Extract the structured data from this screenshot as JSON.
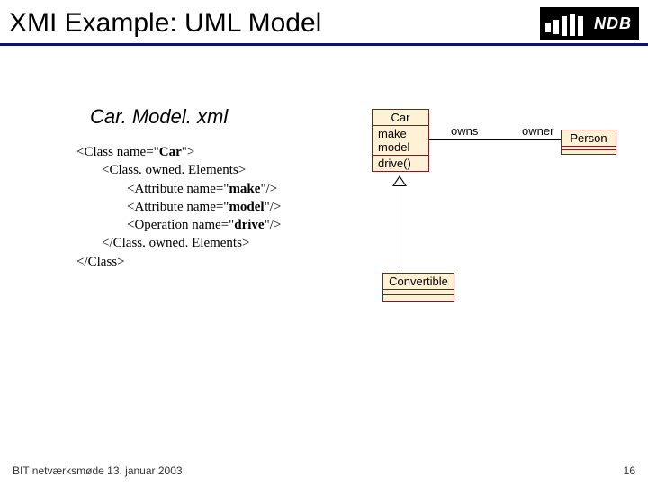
{
  "title": "XMI Example: UML Model",
  "logo": {
    "text": "NDB"
  },
  "subtitle": "Car. Model. xml",
  "xml": {
    "l1a": "<Class name=\"",
    "l1b": "Car",
    "l1c": "\">",
    "l2": "<Class. owned. Elements>",
    "l3a_pre": "<Attribute name=\"",
    "l3a_b": "make",
    "l3a_post": "\"/>",
    "l3b_pre": "<Attribute name=\"",
    "l3b_b": "model",
    "l3b_post": "\"/>",
    "l3c_pre": "<Operation name=\"",
    "l3c_b": "drive",
    "l3c_post": "\"/>",
    "l2c": "</Class. owned. Elements>",
    "l1close": "</Class>"
  },
  "uml": {
    "car": {
      "name": "Car",
      "attr1": "make",
      "attr2": "model",
      "op1": "drive()"
    },
    "person": {
      "name": "Person"
    },
    "convertible": {
      "name": "Convertible"
    },
    "assoc": {
      "owns": "owns",
      "owner": "owner"
    }
  },
  "footer": {
    "left": "BIT netværksmøde 13. januar 2003",
    "right": "16"
  }
}
